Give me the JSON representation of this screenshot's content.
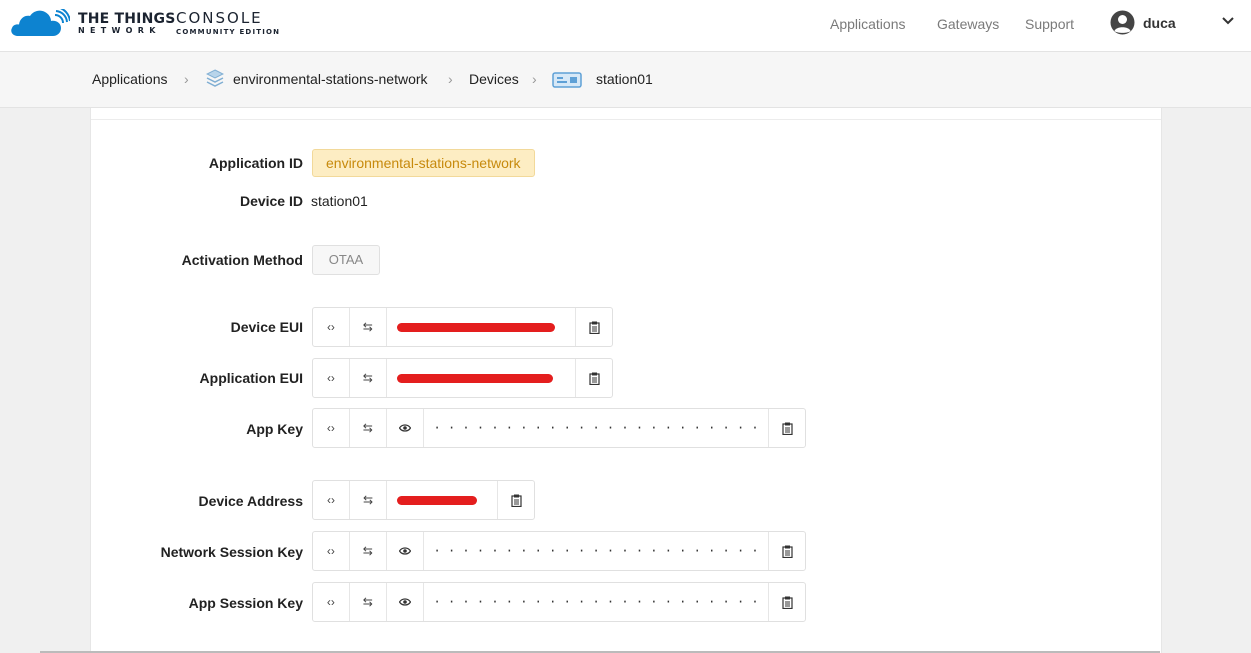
{
  "brand": {
    "logo_main": "THE THINGS",
    "logo_sub": "NETWORK",
    "console_main": "CONSOLE",
    "console_sub": "COMMUNITY EDITION",
    "brand_color": "#0d83d0"
  },
  "nav": {
    "applications": "Applications",
    "gateways": "Gateways",
    "support": "Support",
    "user_name": "duca"
  },
  "breadcrumb": {
    "applications": "Applications",
    "application": "environmental-stations-network",
    "devices": "Devices",
    "device": "station01"
  },
  "device": {
    "application_id_label": "Application ID",
    "application_id": "environmental-stations-network",
    "device_id_label": "Device ID",
    "device_id": "station01",
    "activation_method_label": "Activation Method",
    "activation_method": "OTAA",
    "device_eui_label": "Device EUI",
    "application_eui_label": "Application EUI",
    "app_key_label": "App Key",
    "app_key_masked": "· · · · · · · · · · · · · · · · · · · · · · · · · · · · · · ·",
    "device_address_label": "Device Address",
    "network_session_key_label": "Network Session Key",
    "network_session_key_masked": "· · · · · · · · · · · · · · · · · · · · · · · · · · · · · · ·",
    "app_session_key_label": "App Session Key",
    "app_session_key_masked": "· · · · · · · · · · · · · · · · · · · · · · · · · · · · · · ·"
  },
  "icons": {
    "code": "‹›",
    "swap": "⇆"
  }
}
